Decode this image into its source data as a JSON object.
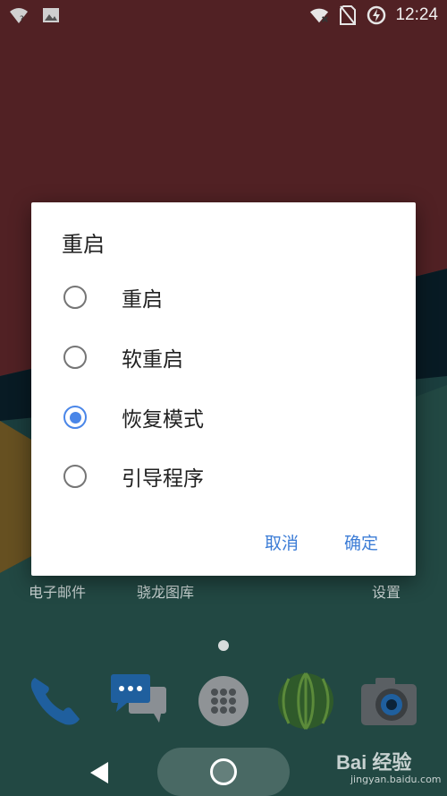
{
  "status_bar": {
    "time": "12:24",
    "left_icons": [
      "wifi-unknown-icon",
      "image-notification-icon"
    ],
    "right_icons": [
      "wifi-off-icon",
      "no-sim-icon",
      "battery-charging-icon"
    ]
  },
  "dialog": {
    "title": "重启",
    "options": [
      {
        "label": "重启",
        "selected": false
      },
      {
        "label": "软重启",
        "selected": false
      },
      {
        "label": "恢复模式",
        "selected": true
      },
      {
        "label": "引导程序",
        "selected": false
      }
    ],
    "cancel_label": "取消",
    "confirm_label": "确定",
    "accent_color": "#4a86e8"
  },
  "home": {
    "app_labels": [
      "电子邮件",
      "骁龙图库",
      "设置"
    ],
    "dock": [
      "phone-icon",
      "messaging-icon",
      "app-drawer-icon",
      "browser-icon",
      "camera-icon"
    ]
  },
  "watermark": {
    "brand": "Bai 经验",
    "url": "jingyan.baidu.com"
  }
}
